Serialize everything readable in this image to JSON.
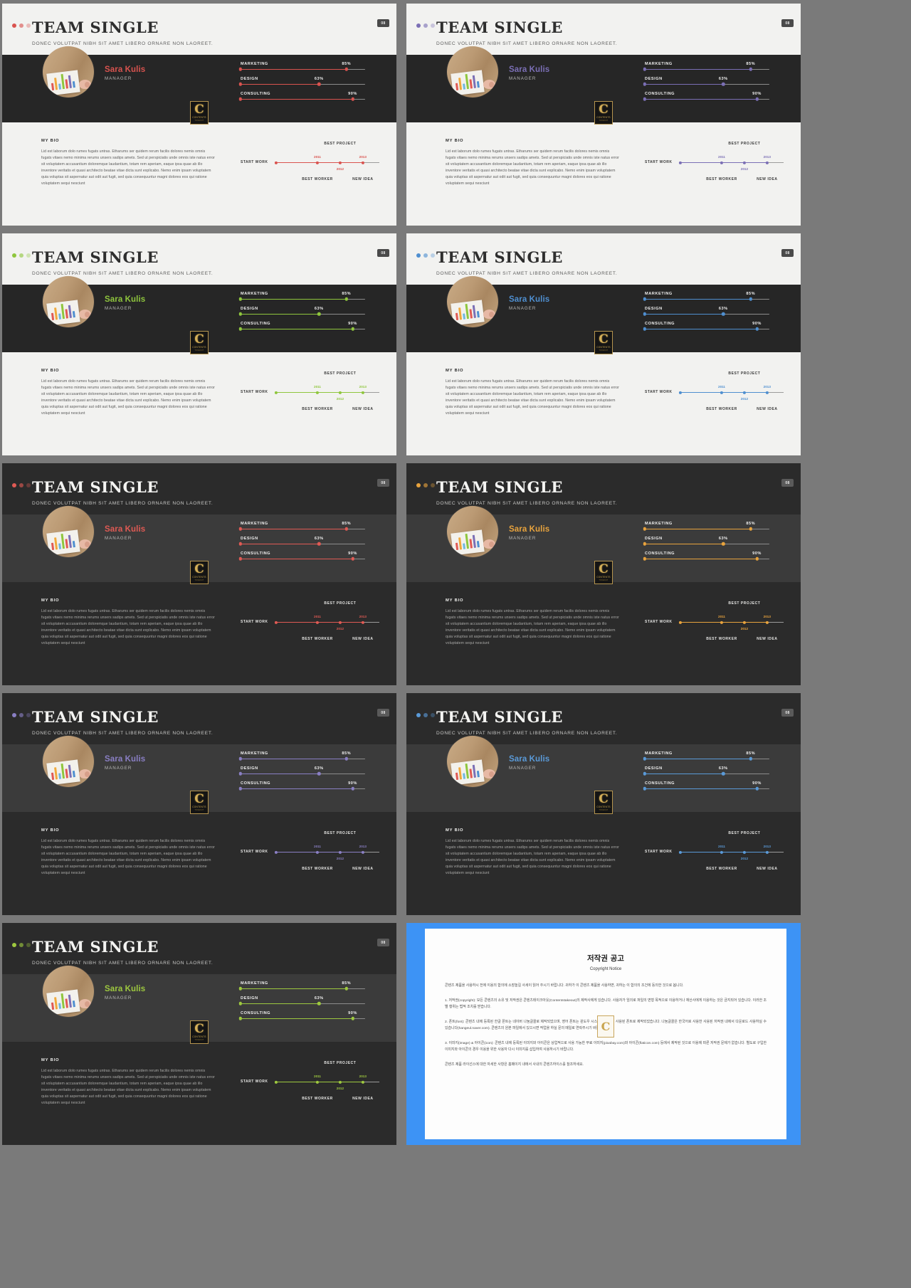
{
  "deck": {
    "title": "TEAM SINGLE",
    "subtitle": "DONEC VOLUTPAT  NIBH SIT AMET LIBERO ORNARE  NON LAOREET.",
    "page_badge": "08",
    "person": {
      "name": "Sara Kulis",
      "role": "MANAGER"
    },
    "bio": {
      "heading": "MY BIO",
      "text": "Lid est laborum dolo rumes fugats untras. Etharums ser quidem rerum facilis dolores nemis omnis fugats vitaes nemo minima rerums unsers sadips amets. Sed ut perspiciatis  unde omnis iste natus error sit voluptatem accusantium doloremque laudantium, totam rem aperiam,  eaque ipsa quae ab illo inventore veritatis et quasi architecto  beatae vitae dicta sunt explicabo.  Nemo enim ipsam voluptatem quia voluptas sit aspernatur  aut odit aut fugit, sed quia consequuntur magni dolores eos qui ratione voluptatem sequi nesciunt"
    },
    "skills": [
      {
        "label": "MARKETING",
        "value": 85,
        "value_label": "85%"
      },
      {
        "label": "DESIGN",
        "value": 63,
        "value_label": "63%"
      },
      {
        "label": "CONSULTING",
        "value": 90,
        "value_label": "90%"
      }
    ],
    "timeline": {
      "start_label": "START WORK",
      "nodes": [
        {
          "year": "2011",
          "caption": "BEST WORKER",
          "caption_pos": "below",
          "pos": 40
        },
        {
          "year": "2012",
          "caption": "",
          "caption_pos": "none",
          "pos": 62
        },
        {
          "year": "2013",
          "caption": "NEW IDEA",
          "caption_pos": "below",
          "pos": 84
        }
      ],
      "top_caption": "BEST PROJECT",
      "year_below": "2012"
    },
    "logo": {
      "letter": "C",
      "line1": "CONTENTS",
      "line2": "TOKEOUT"
    }
  },
  "slides": [
    {
      "index": 1,
      "theme": "light",
      "accent": "#d9534f",
      "badge": "08"
    },
    {
      "index": 2,
      "theme": "light",
      "accent": "#7b6fb5",
      "badge": "08"
    },
    {
      "index": 3,
      "theme": "light",
      "accent": "#8fc63d",
      "badge": "08"
    },
    {
      "index": 4,
      "theme": "light",
      "accent": "#4f8fd0",
      "badge": "08"
    },
    {
      "index": 5,
      "theme": "dark",
      "accent": "#e05a54",
      "badge": "08"
    },
    {
      "index": 6,
      "theme": "dark",
      "accent": "#e8a33d",
      "badge": "08"
    },
    {
      "index": 7,
      "theme": "dark",
      "accent": "#8a7fc4",
      "badge": "08"
    },
    {
      "index": 8,
      "theme": "dark",
      "accent": "#5a9ad8",
      "badge": "08"
    },
    {
      "index": 9,
      "theme": "dark",
      "accent": "#9ec93f",
      "badge": "08"
    }
  ],
  "copyright": {
    "title": "저작권 공고",
    "subtitle": "Copyright Notice",
    "intro": "콘텐츠 제품을 사용하시 전에 이용의 합의에 소장놀길 사세이 읽어 주시기 바랍니다. 귀하가 이 콘텐츠 제품을 사용하면, 귀하는 이 합의의 조건에 동의한 것으로 봅니다.",
    "p1": "1. 저작권(copyright): 모든 콘텐츠의 소유 및 저작권은 콘텐츠테이크아웃(Contentstakeout)의 제작사에게 있습니다. 사용자가 임의로 파일의 변형 목적으로 이용하거나 재산사에게 이용하는 것은 금지되어 있습니다. 이러한 조별 행위는 법적 조치를 받습니다.",
    "p2": "2. 폰트(font): 콘텐츠 내에 등록된 한글 폰트는 네이버 나눔글꼴로 제작되었으며, 영어 폰트는 윈도우 시스템에 등록된 사용된 폰트로 제작되었습니다. 나눔글꼴은 한국어로 사용한 사용된 저작권 내에서 다운로드 사용하실 수 있습니다(hangeul.naver.com). 콘텐츠의 원본 파일에서 있으시면 작업을 하실 문의 메일로 연락주시기 바랍니다.",
    "p3": "3. 이미지(image) & 아이콘(icon): 콘텐츠 내에 등록된 이미지와 아이콘은 상업적으로 사용 가능한 무료 이미지(pixabay.com)와 아이콘(flaticon.com) 등에서 제작된 것으로 이용에 따른 저작권 문제가 없습니다. 별도로 구입한 이미지와 아이콘의 경우 이용을 위한 사용자 다시 이미지를 삽입하여 사용하시기 바랍니다.",
    "p4": "콘텐츠 제품 라이선스에 대한 자세한 사항은 홈페이지 내에서 사내의 콘텐츠하이스를 참조하세요."
  }
}
